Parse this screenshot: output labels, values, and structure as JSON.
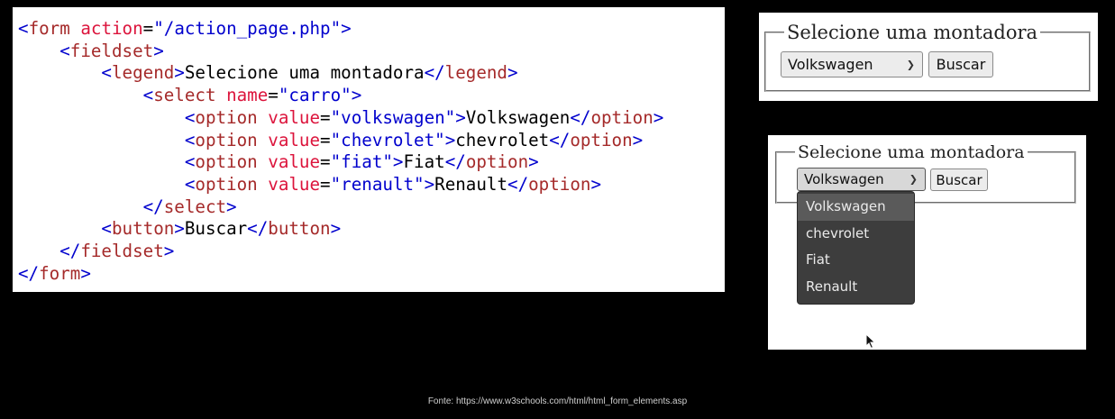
{
  "code": {
    "line1": {
      "open": "<",
      "tag": "form",
      "attr": "action",
      "eq": "=",
      "val": "\"/action_page.php\"",
      "close": ">"
    },
    "line2": {
      "open": "<",
      "tag": "fieldset",
      "close": ">"
    },
    "line3": {
      "open": "<",
      "tag": "legend",
      "close": ">",
      "text": "Selecione uma montadora",
      "end_open": "</",
      "end_tag": "legend",
      "end_close": ">"
    },
    "line4": {
      "open": "<",
      "tag": "select",
      "attr": "name",
      "eq": "=",
      "val": "\"carro\"",
      "close": ">"
    },
    "options": [
      {
        "val": "\"volkswagen\"",
        "text": "Volkswagen"
      },
      {
        "val": "\"chevrolet\"",
        "text": "chevrolet"
      },
      {
        "val": "\"fiat\"",
        "text": "Fiat"
      },
      {
        "val": "\"renault\"",
        "text": "Renault"
      }
    ],
    "opt_tag": "option",
    "opt_attr": "value",
    "line9": {
      "open": "</",
      "tag": "select",
      "close": ">"
    },
    "line10": {
      "open": "<",
      "tag": "button",
      "close": ">",
      "text": "Buscar",
      "end_open": "</",
      "end_tag": "button",
      "end_close": ">"
    },
    "line11": {
      "open": "</",
      "tag": "fieldset",
      "close": ">"
    },
    "line12": {
      "open": "</",
      "tag": "form",
      "close": ">"
    }
  },
  "demo_closed": {
    "legend": "Selecione uma montadora",
    "select_value": "Volkswagen",
    "button_label": "Buscar"
  },
  "demo_open": {
    "legend": "Selecione uma montadora",
    "select_value": "Volkswagen",
    "button_label": "Buscar",
    "options": [
      "Volkswagen",
      "chevrolet",
      "Fiat",
      "Renault"
    ],
    "highlighted": "Volkswagen"
  },
  "caption": "Fonte: https://www.w3schools.com/html/html_form_elements.asp"
}
